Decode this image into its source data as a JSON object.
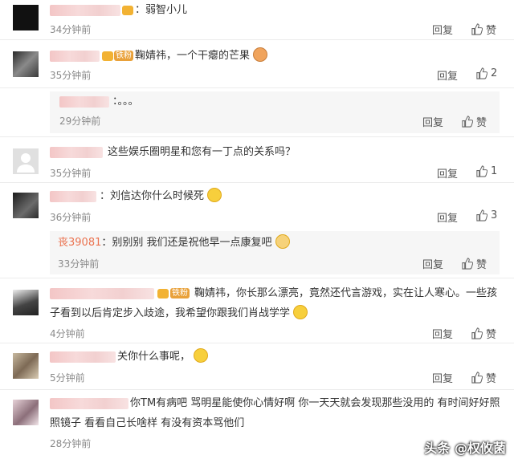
{
  "actions": {
    "reply": "回复",
    "like": "赞"
  },
  "comments": [
    {
      "text": "：弱智小儿",
      "time": "34分钟前",
      "likes": ""
    },
    {
      "text": "鞠婧祎，一个干瘪的芒果",
      "time": "35分钟前",
      "likes": "2",
      "badge": "铁粉"
    },
    {
      "text": "：。。。",
      "time": "29分钟前",
      "likes": ""
    },
    {
      "text": "这些娱乐圈明星和您有一丁点的关系吗？",
      "time": "35分钟前",
      "likes": "1"
    },
    {
      "text": "：刘信达你什么时候死",
      "time": "36分钟前",
      "likes": "3"
    },
    {
      "user": "丧39081",
      "text": "：别别别 我们还是祝他早一点康复吧",
      "time": "33分钟前",
      "likes": ""
    },
    {
      "line1": "鞠婧祎，你长那么漂亮，竟然还代言游戏，实在让人寒心。一些孩",
      "line2": "子看到以后肯定步入歧途，我希望你跟我们肖战学学",
      "time": "4分钟前",
      "likes": "",
      "badge": "铁粉"
    },
    {
      "text": "关你什么事呢，",
      "time": "5分钟前",
      "likes": ""
    },
    {
      "line1": "你TM有病吧 骂明星能使你心情好啊 你一天天就会发现那些没用的 有时间好好照",
      "line2": "照镜子 看看自己长啥样 有没有资本骂他们",
      "time": "28分钟前",
      "likes": ""
    }
  ],
  "watermark": "头条 @权攸菌"
}
